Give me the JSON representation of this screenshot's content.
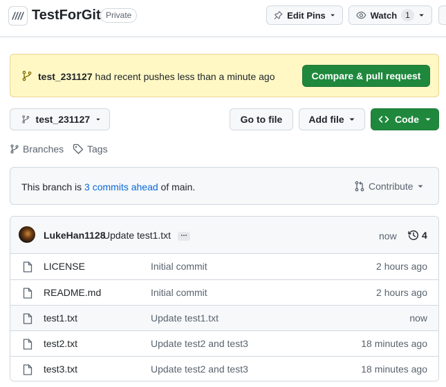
{
  "header": {
    "repo_name": "TestForGit",
    "visibility": "Private",
    "edit_pins_label": "Edit Pins",
    "watch_label": "Watch",
    "watch_count": "1"
  },
  "banner": {
    "branch": "test_231127",
    "message": "had recent pushes less than a minute ago",
    "compare_label": "Compare & pull request"
  },
  "toolbar": {
    "branch_selector": "test_231127",
    "go_to_file": "Go to file",
    "add_file": "Add file",
    "code": "Code"
  },
  "links": {
    "branches": "Branches",
    "tags": "Tags"
  },
  "ahead": {
    "prefix": "This branch is",
    "link": "3 commits ahead",
    "suffix": "of main.",
    "contribute": "Contribute"
  },
  "latest_commit": {
    "author": "LukeHan1128",
    "message": "Update test1.txt",
    "ellipsis": "…",
    "time": "now",
    "history_count": "4"
  },
  "files": [
    {
      "name": "LICENSE",
      "message": "Initial commit",
      "time": "2 hours ago"
    },
    {
      "name": "README.md",
      "message": "Initial commit",
      "time": "2 hours ago"
    },
    {
      "name": "test1.txt",
      "message": "Update test1.txt",
      "time": "now"
    },
    {
      "name": "test2.txt",
      "message": "Update test2 and test3",
      "time": "18 minutes ago"
    },
    {
      "name": "test3.txt",
      "message": "Update test2 and test3",
      "time": "18 minutes ago"
    }
  ],
  "colors": {
    "primary_green": "#1f883d",
    "banner_bg": "#fff8c5",
    "link_blue": "#0969da",
    "border": "#d0d7de"
  },
  "icons": {
    "logo": "repo-logo-icon",
    "pin": "pin-icon",
    "eye": "eye-icon",
    "branch": "git-branch-icon",
    "tag": "tag-icon",
    "pull_request": "git-pull-request-icon",
    "history": "history-icon",
    "file": "file-icon",
    "code": "code-icon",
    "caret": "triangle-down-icon"
  }
}
